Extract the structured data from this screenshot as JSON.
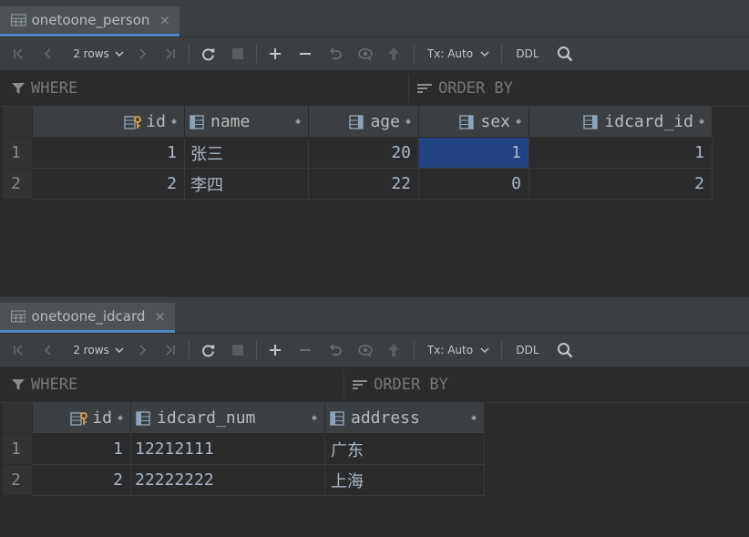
{
  "panes": [
    {
      "tab": {
        "title": "onetoone_person",
        "close": "×"
      },
      "toolbar": {
        "rows": "2 rows",
        "tx": "Tx: Auto",
        "ddl": "DDL"
      },
      "filter": {
        "where": "WHERE",
        "order_by": "ORDER BY"
      },
      "columns": [
        "id",
        "name",
        "age",
        "sex",
        "idcard_id"
      ],
      "rownums": [
        "1",
        "2"
      ],
      "rows": [
        [
          "1",
          "张三",
          "20",
          "1",
          "1"
        ],
        [
          "2",
          "李四",
          "22",
          "0",
          "2"
        ]
      ],
      "selected_cell": "row 1, sex"
    },
    {
      "tab": {
        "title": "onetoone_idcard",
        "close": "×"
      },
      "toolbar": {
        "rows": "2 rows",
        "tx": "Tx: Auto",
        "ddl": "DDL"
      },
      "filter": {
        "where": "WHERE",
        "order_by": "ORDER BY"
      },
      "columns": [
        "id",
        "idcard_num",
        "address"
      ],
      "rownums": [
        "1",
        "2"
      ],
      "rows": [
        [
          "1",
          "12212111",
          "广东"
        ],
        [
          "2",
          "22222222",
          "上海"
        ]
      ]
    }
  ],
  "colors": {
    "background": "#2b2b2b",
    "toolbar": "#3c3f41",
    "selection": "#214283",
    "accent": "#4a88c7"
  }
}
